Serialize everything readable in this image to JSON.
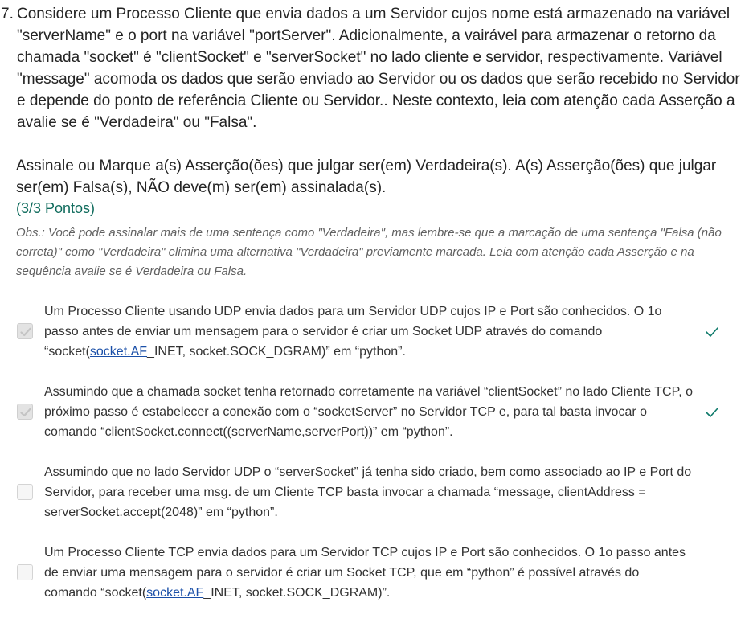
{
  "question": {
    "number": "7.",
    "text": "Considere um Processo Cliente que envia dados a um Servidor cujos nome está armazenado na variável \"serverName\" e o port na variável \"portServer\". Adicionalmente, a vairável para armazenar o retorno da chamada \"socket\" é \"clientSocket\" e \"serverSocket\" no lado cliente e servidor, respectivamente. Variável \"message\" acomoda os dados que serão enviado ao Servidor ou os dados que serão recebido no Servidor e depende do ponto de referência Cliente ou Servidor.. Neste contexto, leia com atenção cada Asserção a avalie se é \"Verdadeira\" ou \"Falsa\".",
    "instruction": "Assinale ou Marque a(s) Asserção(ões) que julgar ser(em) Verdadeira(s). A(s) Asserção(ões) que julgar ser(em) Falsa(s), NÃO deve(m) ser(em) assinalada(s).",
    "points": "(3/3 Pontos)",
    "obs": "Obs.: Você pode assinalar mais de uma sentença como \"Verdadeira\", mas lembre-se que a marcação de uma sentença \"Falsa (não correta)\" como \"Verdadeira\" elimina uma alternativa \"Verdadeira\" previamente marcada. Leia com atenção cada Asserção e na sequência avalie se é Verdadeira ou Falsa."
  },
  "options": [
    {
      "before": "Um Processo Cliente usando UDP envia dados para um Servidor UDP cujos IP e Port são conhecidos. O 1o passo antes de enviar um mensagem para o servidor é criar um Socket UDP através do comando “socket(",
      "link": "socket.AF",
      "after": "_INET, socket.SOCK_DGRAM)” em “python”.",
      "checked": true,
      "correct_mark": true
    },
    {
      "text": "Assumindo que a chamada socket tenha retornado corretamente na variável “clientSocket” no lado Cliente TCP, o próximo passo é estabelecer a conexão com o “socketServer” no Servidor TCP e, para tal basta invocar o comando “clientSocket.connect((serverName,serverPort))” em “python”.",
      "checked": true,
      "correct_mark": true
    },
    {
      "text": "Assumindo que no lado Servidor UDP o “serverSocket” já tenha sido criado, bem como associado ao IP e Port do Servidor, para receber uma msg. de um Cliente TCP basta invocar a chamada “message, clientAddress = serverSocket.accept(2048)” em “python”.",
      "checked": false,
      "correct_mark": false
    },
    {
      "before": "Um Processo Cliente TCP envia dados para um Servidor TCP cujos IP e Port são conhecidos. O 1o passo antes de enviar uma mensagem para o servidor é criar um Socket TCP, que em “python” é possível através do comando “socket(",
      "link": "socket.AF",
      "after": "_INET, socket.SOCK_DGRAM)”.",
      "checked": false,
      "correct_mark": false
    }
  ],
  "colors": {
    "points": "#0f6b5c",
    "check_mark": "#0f7a6b",
    "link": "#1a4fa8"
  }
}
